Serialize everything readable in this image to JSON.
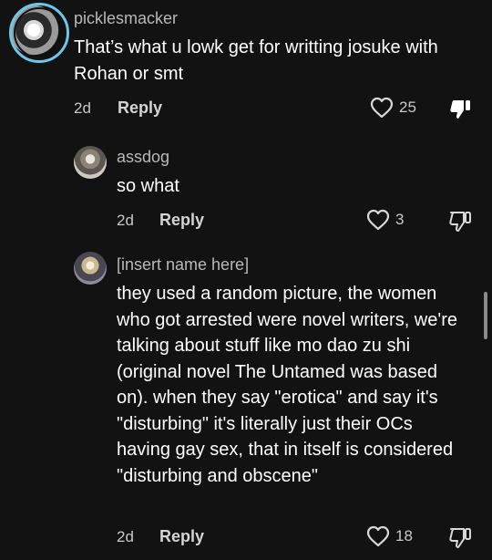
{
  "comments": [
    {
      "username": "picklesmacker",
      "text": "That’s what u lowk get for writting josuke with Rohan or smt",
      "age": "2d",
      "reply_label": "Reply",
      "likes": "25",
      "disliked": true
    },
    {
      "username": "assdog",
      "text": "so what",
      "age": "2d",
      "reply_label": "Reply",
      "likes": "3",
      "disliked": false
    },
    {
      "username": "[insert name here]",
      "text": "they used a random picture, the women who got arrested were novel writers, we're talking about stuff like mo dao zu shi (original novel The Untamed was based on). when they say \"erotica\" and say it's \"disturbing\" it's literally just their OCs having gay sex, that in itself is considered \"disturbing and obscene\"",
      "age": "2d",
      "reply_label": "Reply",
      "likes": "18",
      "disliked": false
    }
  ],
  "colors": {
    "background": "#121212",
    "avatar_ring": "#6ec6e8",
    "muted_text": "#b9b9b9"
  },
  "icons": {
    "like": "heart-outline-icon",
    "dislike_filled": "thumbs-down-filled-icon",
    "dislike_outline": "thumbs-down-outline-icon"
  }
}
